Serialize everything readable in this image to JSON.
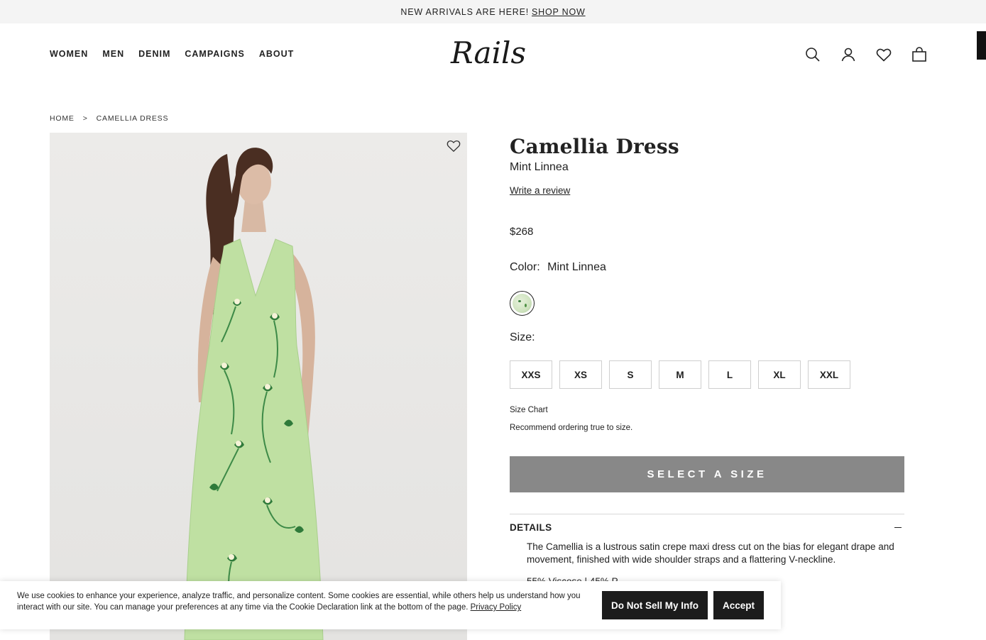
{
  "promo": {
    "text": "NEW ARRIVALS ARE HERE!",
    "link": "SHOP NOW"
  },
  "nav": {
    "items": [
      "WOMEN",
      "MEN",
      "DENIM",
      "CAMPAIGNS",
      "ABOUT"
    ]
  },
  "logo": {
    "text": "Rails"
  },
  "header_icons": [
    "search-icon",
    "account-icon",
    "wishlist-icon",
    "bag-icon"
  ],
  "breadcrumb": {
    "home": "HOME",
    "separator": ">",
    "current": "CAMELLIA DRESS"
  },
  "product": {
    "title": "Camellia Dress",
    "subtitle": "Mint Linnea",
    "review_link": "Write a review",
    "price": "$268",
    "color_label": "Color:",
    "color_value": "Mint Linnea",
    "size_label": "Size:",
    "sizes": [
      "XXS",
      "XS",
      "S",
      "M",
      "L",
      "XL",
      "XXL"
    ],
    "size_chart": "Size Chart",
    "size_note": "Recommend ordering true to size.",
    "cta": "SELECT A SIZE",
    "details_label": "DETAILS",
    "details_text": "The Camellia is a lustrous satin crepe maxi dress cut on the bias for elegant drape and movement, finished with wide shoulder straps and a flattering V-neckline.",
    "fabric": "55% Viscose | 45% P..."
  },
  "cookie": {
    "text": "We use cookies to enhance your experience, analyze traffic, and personalize content. Some cookies are essential, while others help us understand how you interact with our site. You can manage your preferences at any time via the Cookie Declaration link at the bottom of the page.",
    "link": "Privacy Policy",
    "dns_button": "Do Not Sell My Info",
    "accept_button": "Accept"
  },
  "colors": {
    "cta_disabled": "#888888",
    "dark": "#1c1c1c",
    "promo_bg": "#f4f4f4"
  }
}
